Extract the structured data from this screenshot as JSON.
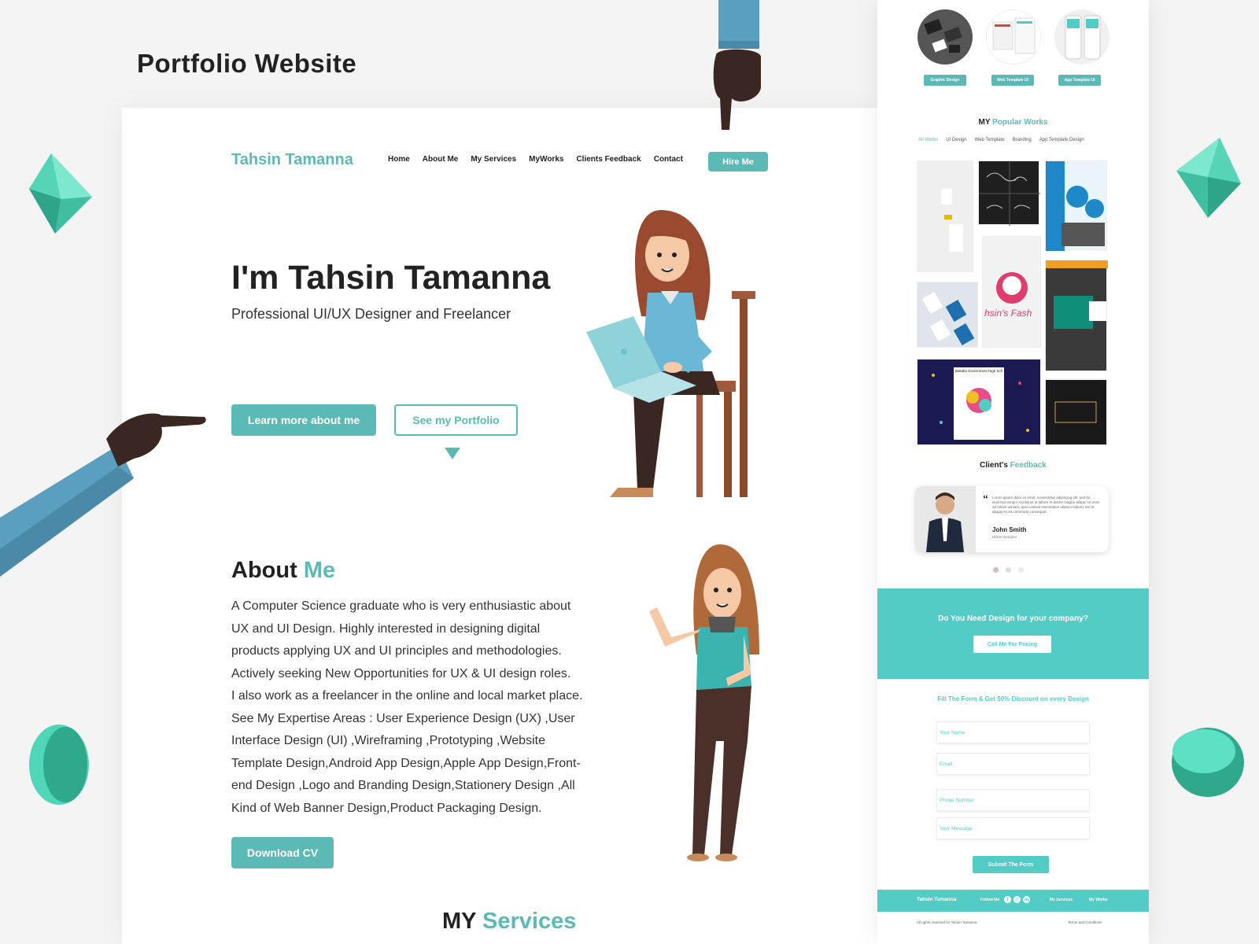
{
  "showcase_title": "Portfolio Website",
  "colors": {
    "accent": "#5bbab6",
    "accent_bright": "#53ccc6",
    "gem": "#55d4b6"
  },
  "main": {
    "brand": "Tahsin Tamanna",
    "nav": [
      "Home",
      "About Me",
      "My Services",
      "MyWorks",
      "Clients Feedback",
      "Contact"
    ],
    "hire_button": "Hire Me",
    "hero_title": "I'm Tahsin Tamanna",
    "hero_subtitle": "Professional UI/UX Designer and Freelancer",
    "learn_button": "Learn more about me",
    "portfolio_button": "See my Portfolio",
    "about_title_a": "About",
    "about_title_b": "Me",
    "about_lines": [
      "A Computer Science graduate who is very enthusiastic about",
      "UX and UI Design. Highly interested in designing digital",
      "products applying UX and UI principles and methodologies.",
      "Actively seeking New Opportunities for UX & UI design roles.",
      "I also work as a freelancer in the online and local market place.",
      "See My Expertise Areas : User Experience Design (UX) ,User",
      "Interface Design (UI) ,Wireframing ,Prototyping ,Website",
      "Template Design,Android App Design,Apple App Design,Front-",
      "end Design ,Logo and Branding Design,Stationery Design ,All",
      "Kind of Web Banner Design,Product Packaging Design."
    ],
    "cv_button": "Download CV",
    "services_title_a": "MY",
    "services_title_b": "Services"
  },
  "side": {
    "categories": [
      "Graphic Design",
      "Web Template UI",
      "App Template UI"
    ],
    "popular_title_a": "MY",
    "popular_title_b": "Popular Works",
    "tabs": [
      "All Works",
      "UI Design",
      "Web Template",
      "Branding",
      "App Template Design"
    ],
    "tile_texts": {
      "fashion_logo": "hsin's Fash",
      "banner_school": "Bakalia Government High School"
    },
    "feedback_title_a": "Client's",
    "feedback_title_b": "Feedback",
    "feedback": {
      "quote_mark": "“",
      "text": "Lorem ipsum dolor sit amet, consectetur adipiscing elit, sed do eiusmod tempor incididunt ut labore et dolore magna aliqua. Ut enim ad minim veniam, quis nostrud exercitation ullamco laboris nisi ut aliquip ex ea commodo consequat.",
      "name": "John Smith",
      "role": "UI/UX Designer"
    },
    "cta_text": "Do You Need Design for your company?",
    "cta_button": "Call Me For Pricing",
    "form_title": "Fill The Form & Get 50% Discount on every Design",
    "fields": [
      "Your Name",
      "Email",
      "Phone Number",
      "Your Message"
    ],
    "submit_button": "Submit The Form",
    "footer": {
      "brand": "Tahsin Tamanna",
      "follow": "Follow Me",
      "social_icons": [
        "facebook-icon",
        "instagram-icon",
        "linkedin-icon"
      ],
      "link1": "My Services",
      "link2": "My Works"
    },
    "copyright": "All rights reserved for Tahsin Tamanna",
    "terms": "Terms and Conditions"
  }
}
